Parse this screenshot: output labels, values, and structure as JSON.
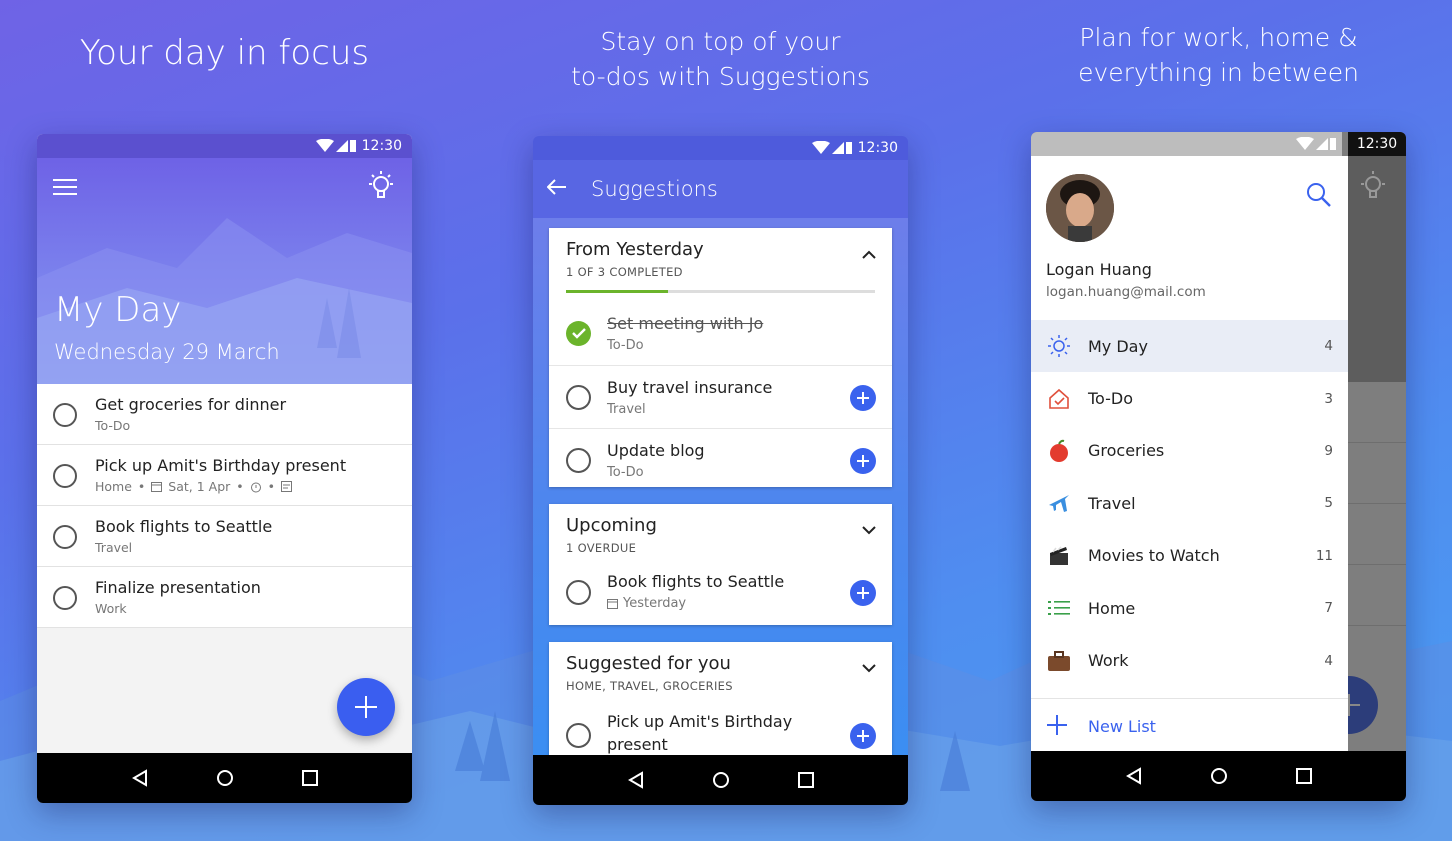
{
  "colors": {
    "accent": "#3a5ef0",
    "complete": "#6bb42b"
  },
  "panels": [
    {
      "headline": "Your day in focus"
    },
    {
      "headline_lines": [
        "Stay on top of your",
        "to-dos with Suggestions"
      ]
    },
    {
      "headline_lines": [
        "Plan for work, home &",
        "everything in between"
      ]
    }
  ],
  "status": {
    "time": "12:30"
  },
  "myday": {
    "menu_icon": "hamburger-menu-icon",
    "bulb_icon": "lightbulb-icon",
    "title": "My Day",
    "date": "Wednesday 29 March",
    "tasks": [
      {
        "title": "Get groceries for dinner",
        "list": "To-Do"
      },
      {
        "title": "Pick up Amit's Birthday present",
        "list": "Home",
        "due": "Sat, 1 Apr"
      },
      {
        "title": "Book flights to Seattle",
        "list": "Travel"
      },
      {
        "title": "Finalize presentation",
        "list": "Work"
      }
    ]
  },
  "suggestions": {
    "title": "Suggestions",
    "sections": [
      {
        "heading": "From Yesterday",
        "sub": "1 OF 3 COMPLETED",
        "progress": 0.33,
        "items": [
          {
            "title": "Set meeting with Jo",
            "list": "To-Do",
            "completed": true
          },
          {
            "title": "Buy travel insurance",
            "list": "Travel"
          },
          {
            "title": "Update blog",
            "list": "To-Do"
          }
        ]
      },
      {
        "heading": "Upcoming",
        "sub": "1 OVERDUE",
        "items": [
          {
            "title": "Book flights to Seattle",
            "due": "Yesterday"
          }
        ]
      },
      {
        "heading": "Suggested for you",
        "sub": "HOME, TRAVEL, GROCERIES",
        "items": [
          {
            "title_line1": "Pick up Amit's Birthday",
            "title_line2": "present"
          }
        ]
      }
    ]
  },
  "drawer": {
    "user": {
      "name": "Logan Huang",
      "email": "logan.huang@mail.com"
    },
    "lists": [
      {
        "label": "My Day",
        "count": "4",
        "icon": "sun-icon"
      },
      {
        "label": "To-Do",
        "count": "3",
        "icon": "home-check-icon"
      },
      {
        "label": "Groceries",
        "count": "9",
        "icon": "apple-icon"
      },
      {
        "label": "Travel",
        "count": "5",
        "icon": "airplane-icon"
      },
      {
        "label": "Movies to Watch",
        "count": "11",
        "icon": "clapperboard-icon"
      },
      {
        "label": "Home",
        "count": "7",
        "icon": "list-icon"
      },
      {
        "label": "Work",
        "count": "4",
        "icon": "briefcase-icon"
      }
    ],
    "new_list": "New List"
  }
}
